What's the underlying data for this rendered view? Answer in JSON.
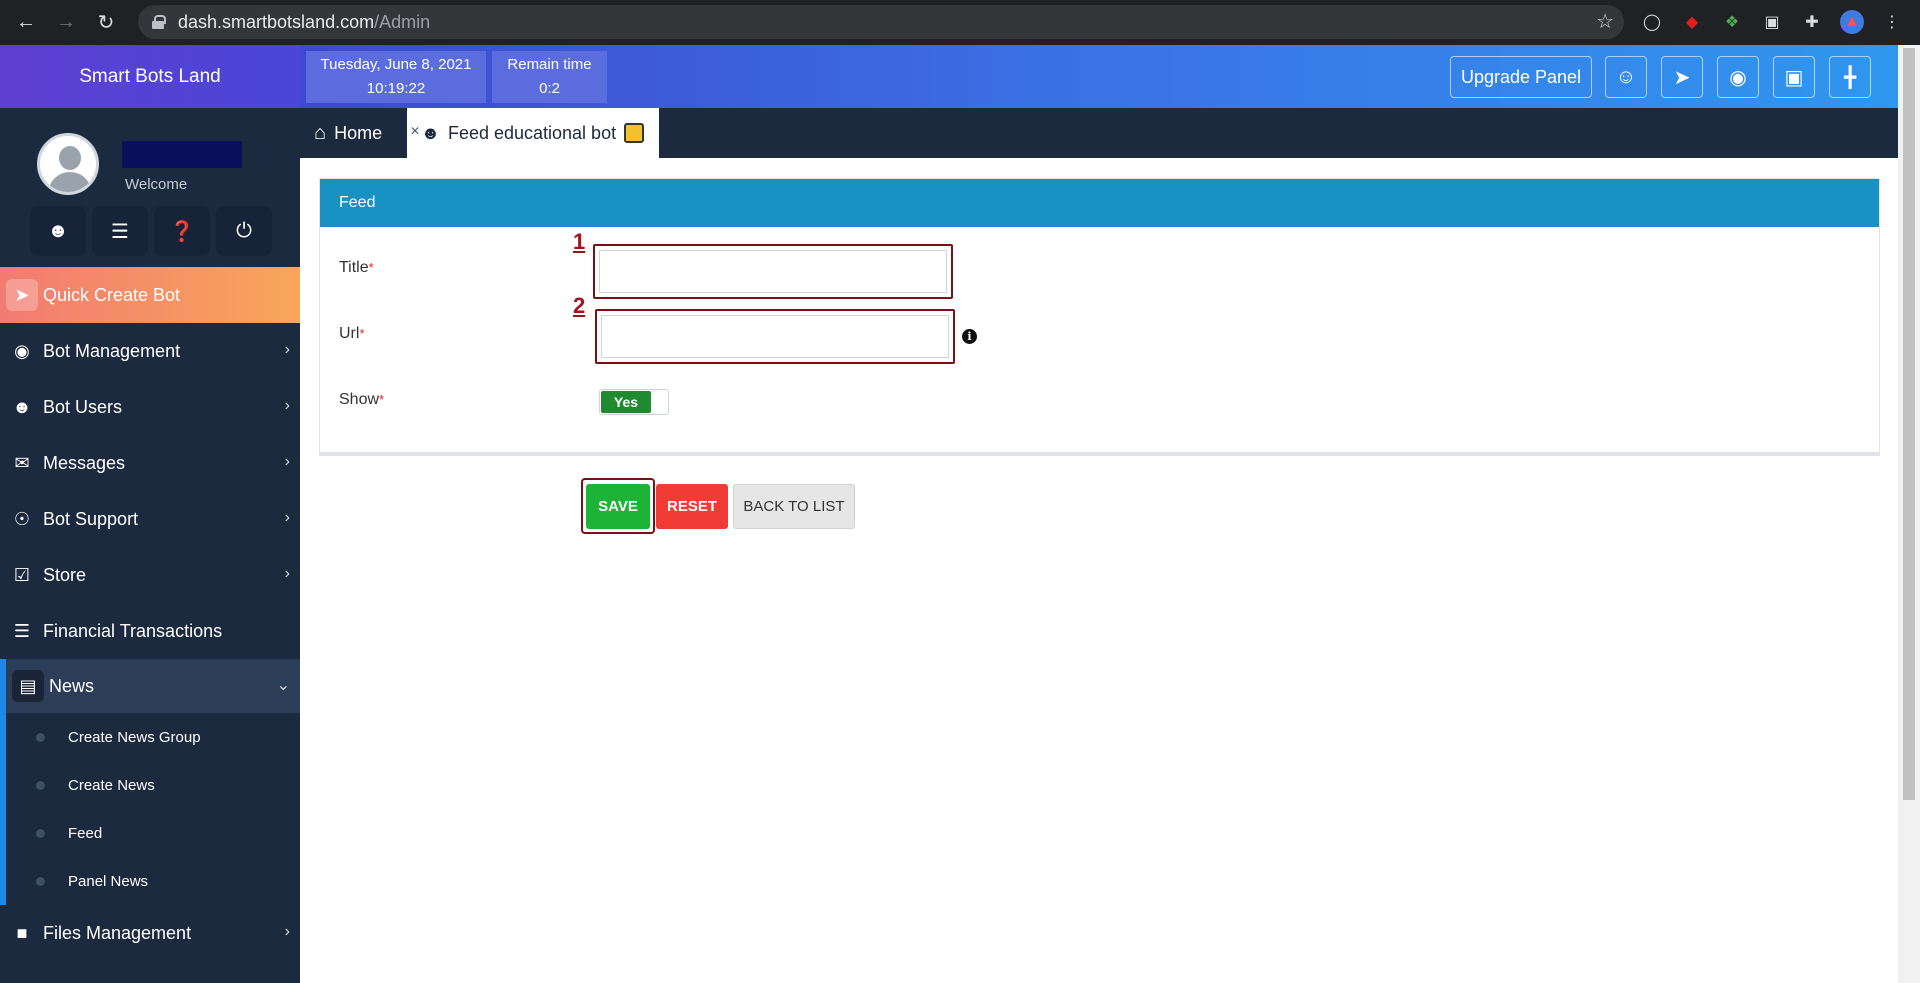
{
  "browser": {
    "url_host": "dash.smartbotsland.com",
    "url_path": "/Admin"
  },
  "sidebar": {
    "brand": "Smart Bots Land",
    "welcome": "Welcome",
    "quick_create": "Quick Create Bot",
    "items": [
      {
        "label": "Bot Management",
        "icon": "android-icon"
      },
      {
        "label": "Bot Users",
        "icon": "user-icon"
      },
      {
        "label": "Messages",
        "icon": "envelope-icon"
      },
      {
        "label": "Bot Support",
        "icon": "support-icon"
      },
      {
        "label": "Store",
        "icon": "cart-icon"
      },
      {
        "label": "Financial Transactions",
        "icon": "receipt-icon"
      }
    ],
    "active_item": "News",
    "news_submenu": [
      "Create News Group",
      "Create News",
      "Feed",
      "Panel News"
    ],
    "files_item": "Files Management"
  },
  "header": {
    "date": "Tuesday, June 8, 2021",
    "time": "10:19:22",
    "remain_label": "Remain time",
    "remain_value": "0:2",
    "upgrade_label": "Upgrade Panel"
  },
  "tabs": {
    "home": "Home",
    "active": "Feed educational bot"
  },
  "form": {
    "panel_title": "Feed",
    "title_label": "Title",
    "url_label": "Url",
    "show_label": "Show",
    "required_mark": "*",
    "mark1": "1",
    "mark2": "2",
    "title_value": "",
    "url_value": "",
    "show_value": "Yes"
  },
  "buttons": {
    "save": "SAVE",
    "reset": "RESET",
    "back": "BACK TO LIST"
  },
  "colors": {
    "sidebar_bg": "#1c2a3f",
    "panel_header": "#1891c3",
    "save": "#1db336",
    "reset": "#f13b35",
    "annotation": "#7a0f16"
  }
}
